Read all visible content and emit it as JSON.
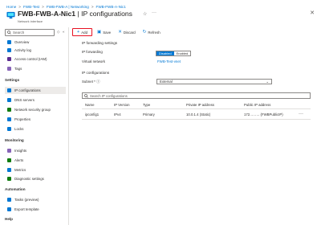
{
  "breadcrumb": [
    "Home",
    "FWB-Test",
    "FWB-FWB-A | Networking",
    "FWB-FWB-A-Nic1"
  ],
  "header": {
    "title_bold": "FWB-FWB-A-Nic1",
    "title_rest": " | IP configurations",
    "subtitle": "Network interface"
  },
  "sidebar": {
    "search_placeholder": "Search",
    "items_top": [
      {
        "label": "Overview",
        "color": "#0078d4"
      },
      {
        "label": "Activity log",
        "color": "#0078d4"
      },
      {
        "label": "Access control (IAM)",
        "color": "#5c2d91"
      },
      {
        "label": "Tags",
        "color": "#8764b8"
      }
    ],
    "sec_settings": "Settings",
    "items_settings": [
      {
        "label": "IP configurations",
        "color": "#0078d4"
      },
      {
        "label": "DNS servers",
        "color": "#0078d4"
      },
      {
        "label": "Network security group",
        "color": "#107c10"
      },
      {
        "label": "Properties",
        "color": "#0078d4"
      },
      {
        "label": "Locks",
        "color": "#0078d4"
      }
    ],
    "sec_monitoring": "Monitoring",
    "items_monitoring": [
      {
        "label": "Insights",
        "color": "#8764b8"
      },
      {
        "label": "Alerts",
        "color": "#107c10"
      },
      {
        "label": "Metrics",
        "color": "#0078d4"
      },
      {
        "label": "Diagnostic settings",
        "color": "#107c10"
      }
    ],
    "sec_automation": "Automation",
    "items_automation": [
      {
        "label": "Tasks (preview)",
        "color": "#0078d4"
      },
      {
        "label": "Export template",
        "color": "#0078d4"
      }
    ],
    "sec_help": "Help"
  },
  "toolbar": {
    "add": "Add",
    "save": "Save",
    "discard": "Discard",
    "refresh": "Refresh"
  },
  "main": {
    "ip_forwarding_settings": "IP forwarding settings",
    "ip_forwarding_label": "IP forwarding",
    "toggle_disabled": "Disabled",
    "toggle_enabled": "Enabled",
    "virtual_network_label": "Virtual network",
    "virtual_network_value": "FWB-Test-vnet",
    "ip_configurations": "IP configurations",
    "subnet_label": "Subnet *",
    "subnet_value": "External",
    "search_placeholder": "Search IP configurations",
    "columns": [
      "Name",
      "IP Version",
      "Type",
      "Private IP address",
      "Public IP address"
    ],
    "row": {
      "name": "ipconfig1",
      "version": "IPv4",
      "type": "Primary",
      "private_ip": "10.0.1.4 (Static)",
      "public_ip": "172.…….. (FWBPublicIP)"
    }
  }
}
